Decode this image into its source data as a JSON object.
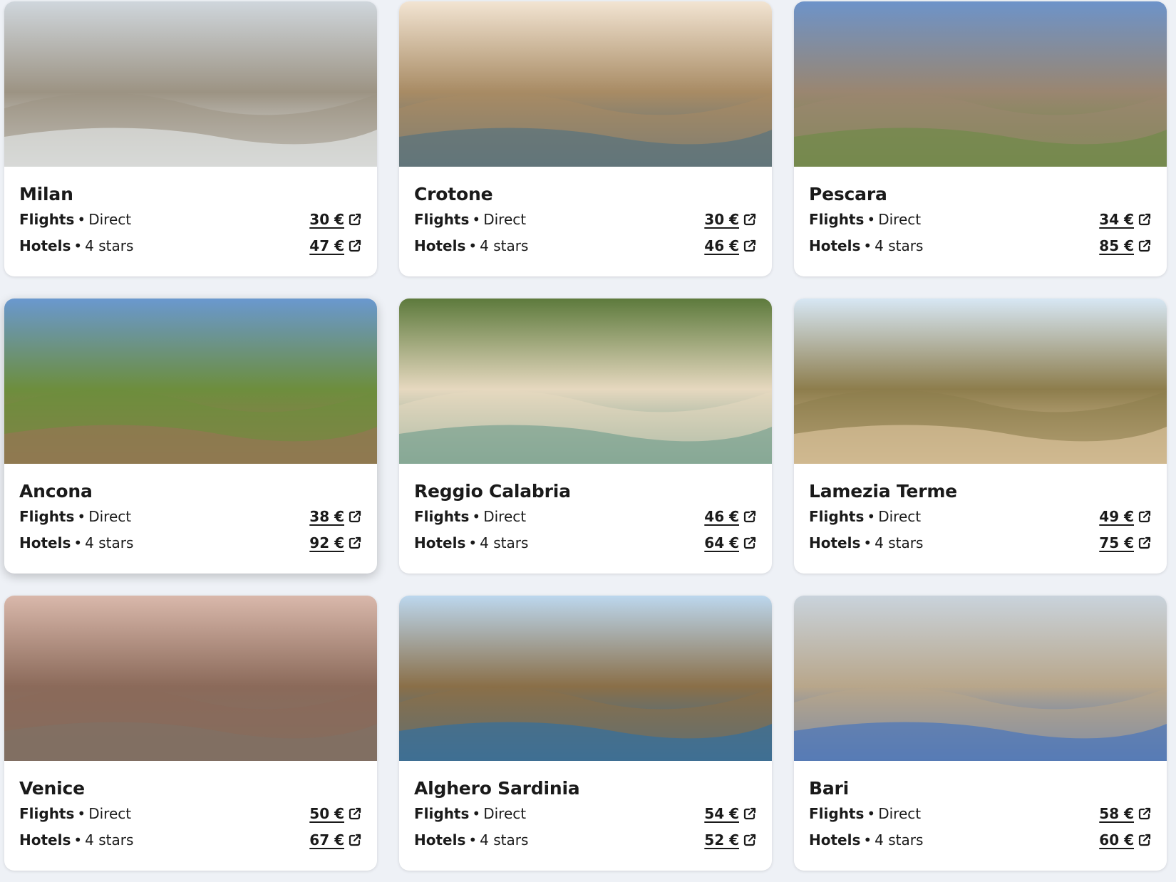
{
  "labels": {
    "flights": "Flights",
    "hotels": "Hotels",
    "separator": "•"
  },
  "destinations": [
    {
      "city": "Milan",
      "flight_type": "Direct",
      "flight_price": "30 €",
      "hotel_class": "4 stars",
      "hotel_price": "47 €",
      "image": "cathedral-spires-photo",
      "palette": [
        "#cfd6dc",
        "#9c9383",
        "#e8ecef"
      ]
    },
    {
      "city": "Crotone",
      "flight_type": "Direct",
      "flight_price": "30 €",
      "hotel_class": "4 stars",
      "hotel_price": "46 €",
      "image": "sea-fortress-photo",
      "palette": [
        "#f2e4d2",
        "#a88b64",
        "#4f6f80"
      ]
    },
    {
      "city": "Pescara",
      "flight_type": "Direct",
      "flight_price": "34 €",
      "hotel_class": "4 stars",
      "hotel_price": "85 €",
      "image": "stone-arches-church-photo",
      "palette": [
        "#6d93c9",
        "#9a8670",
        "#6b8a45"
      ]
    },
    {
      "city": "Ancona",
      "flight_type": "Direct",
      "flight_price": "38 €",
      "hotel_class": "4 stars",
      "hotel_price": "92 €",
      "image": "green-hills-rooftops-photo",
      "palette": [
        "#6a98cf",
        "#6d8e3d",
        "#9a7356"
      ]
    },
    {
      "city": "Reggio Calabria",
      "flight_type": "Direct",
      "flight_price": "46 €",
      "hotel_class": "4 stars",
      "hotel_price": "64 €",
      "image": "beach-town-aerial-photo",
      "palette": [
        "#5d7a3c",
        "#e6d8bf",
        "#6d9b8b"
      ]
    },
    {
      "city": "Lamezia Terme",
      "flight_type": "Direct",
      "flight_price": "49 €",
      "hotel_class": "4 stars",
      "hotel_price": "75 €",
      "image": "cliff-castle-town-photo",
      "palette": [
        "#d7e7f4",
        "#8d7d4c",
        "#e3c9a3"
      ]
    },
    {
      "city": "Venice",
      "flight_type": "Direct",
      "flight_price": "50 €",
      "hotel_class": "4 stars",
      "hotel_price": "67 €",
      "image": "grand-canal-sunset-photo",
      "palette": [
        "#d9b8ab",
        "#8b6a5a",
        "#7e7266"
      ]
    },
    {
      "city": "Alghero Sardinia",
      "flight_type": "Direct",
      "flight_price": "54 €",
      "hotel_class": "4 stars",
      "hotel_price": "52 €",
      "image": "seawall-coast-photo",
      "palette": [
        "#bcd7ee",
        "#8a6f48",
        "#2a6fa8"
      ]
    },
    {
      "city": "Bari",
      "flight_type": "Direct",
      "flight_price": "58 €",
      "hotel_class": "4 stars",
      "hotel_price": "60 €",
      "image": "blue-boats-harbor-photo",
      "palette": [
        "#c9d3dc",
        "#b8a68a",
        "#3c6fc2"
      ]
    }
  ]
}
